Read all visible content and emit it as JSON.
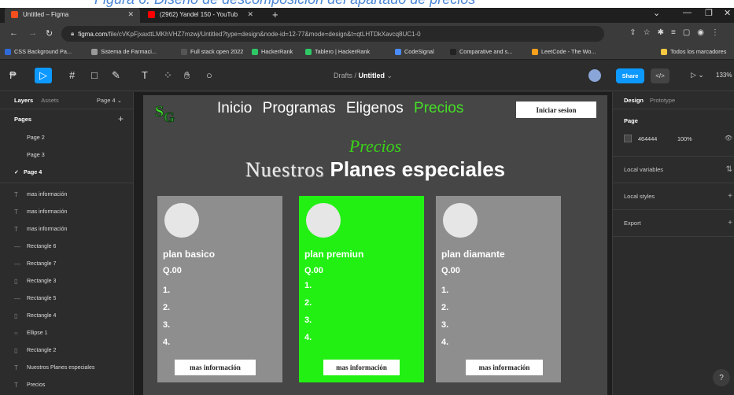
{
  "browser": {
    "tabs": [
      {
        "title": "Untitled – Figma",
        "active": true,
        "color": "#f24e1e"
      },
      {
        "title": "(2962) Yandel 150 - YouTub",
        "active": false,
        "color": "#ff0000"
      }
    ],
    "url_host": "figma.com",
    "url_rest": "/file/cVKpFjxaxttLMKhVHZ7mzwj/Untitled?type=design&node-id=12-77&mode=design&t=qtLHTDkXavcq8UC1-0",
    "bookmarks": [
      {
        "label": "CSS Background Pa...",
        "color": "#2f6bd8"
      },
      {
        "label": "Sistema de Farmaci...",
        "color": "#999999"
      },
      {
        "label": "Full stack open 2022",
        "color": "#555555"
      },
      {
        "label": "HackerRank",
        "color": "#2ec866"
      },
      {
        "label": "Tablero | HackerRank",
        "color": "#2ec866"
      },
      {
        "label": "CodeSignal",
        "color": "#4a8cff"
      },
      {
        "label": "Comparative and s...",
        "color": "#222222"
      },
      {
        "label": "LeetCode - The Wo...",
        "color": "#f89f1b"
      },
      {
        "label": "Todos los marcadores",
        "color": "#f5c842"
      }
    ]
  },
  "figma_toolbar": {
    "breadcrumb_project": "Drafts",
    "breadcrumb_file": "Untitled",
    "share_label": "Share",
    "code_label": "</>",
    "zoom": "133%"
  },
  "left_panel": {
    "tab_layers": "Layers",
    "tab_assets": "Assets",
    "current_page": "Page 4",
    "pages_title": "Pages",
    "pages": [
      "Page 2",
      "Page 3",
      "Page 4"
    ],
    "layers": [
      {
        "icon": "text",
        "label": "mas información"
      },
      {
        "icon": "text",
        "label": "mas información"
      },
      {
        "icon": "text",
        "label": "mas información"
      },
      {
        "icon": "line",
        "label": "Rectangle 6"
      },
      {
        "icon": "line",
        "label": "Rectangle 7"
      },
      {
        "icon": "rect",
        "label": "Rectangle 3"
      },
      {
        "icon": "line",
        "label": "Rectangle 5"
      },
      {
        "icon": "rect",
        "label": "Rectangle 4"
      },
      {
        "icon": "ellipse",
        "label": "Ellipse 1"
      },
      {
        "icon": "rect",
        "label": "Rectangle 2"
      },
      {
        "icon": "text",
        "label": "Nuestros Planes especiales"
      },
      {
        "icon": "text",
        "label": "Precios"
      }
    ]
  },
  "design": {
    "nav": [
      "Inicio",
      "Programas",
      "Eligenos",
      "Precios"
    ],
    "login_label": "Iniciar sesion",
    "subtitle": "Precios",
    "heading_a": "Nuestros",
    "heading_b": "Planes especiales",
    "cards": [
      {
        "name": "plan basico",
        "price": "Q.00",
        "items": [
          "1.",
          "2.",
          "3.",
          "4."
        ],
        "button": "mas información",
        "color": "#8e8e8e"
      },
      {
        "name": "plan premiun",
        "price": "Q.00",
        "items": [
          "1.",
          "2.",
          "3.",
          "4."
        ],
        "button": "mas información",
        "color": "#22f013"
      },
      {
        "name": "plan diamante",
        "price": "Q.00",
        "items": [
          "1.",
          "2.",
          "3.",
          "4."
        ],
        "button": "mas información",
        "color": "#8e8e8e"
      }
    ]
  },
  "right_panel": {
    "tab_design": "Design",
    "tab_prototype": "Prototype",
    "page_title": "Page",
    "page_color_hex": "464444",
    "page_opacity": "100%",
    "sections": [
      "Local variables",
      "Local styles",
      "Export"
    ]
  },
  "help_label": "?"
}
